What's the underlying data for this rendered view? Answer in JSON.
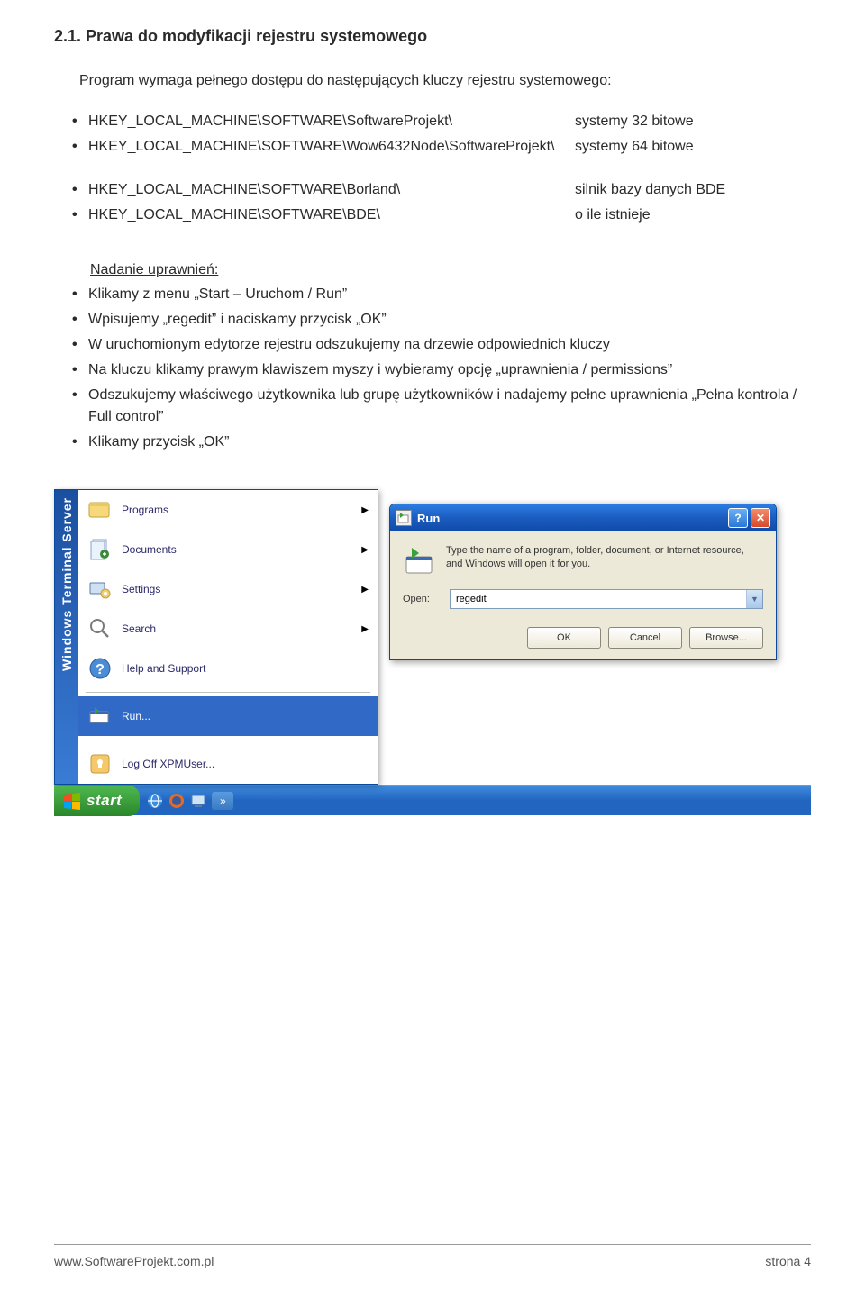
{
  "heading": "2.1. Prawa do modyfikacji rejestru systemowego",
  "intro": "Program wymaga pełnego dostępu do następujących kluczy rejestru systemowego:",
  "registry_group1": [
    {
      "path": "HKEY_LOCAL_MACHINE\\SOFTWARE\\SoftwareProjekt\\",
      "desc": "systemy 32 bitowe"
    },
    {
      "path": "HKEY_LOCAL_MACHINE\\SOFTWARE\\Wow6432Node\\SoftwareProjekt\\",
      "desc": "systemy 64 bitowe"
    }
  ],
  "registry_group2": [
    {
      "path": "HKEY_LOCAL_MACHINE\\SOFTWARE\\Borland\\",
      "desc": "silnik bazy danych BDE"
    },
    {
      "path": "HKEY_LOCAL_MACHINE\\SOFTWARE\\BDE\\",
      "desc": "o ile istnieje"
    }
  ],
  "subheading": "Nadanie uprawnień:",
  "steps": [
    "Klikamy z menu „Start – Uruchom / Run”",
    "Wpisujemy „regedit” i naciskamy przycisk „OK”",
    "W uruchomionym edytorze rejestru odszukujemy na drzewie odpowiednich kluczy",
    "Na kluczu klikamy prawym klawiszem myszy i wybieramy opcję „uprawnienia / permissions”",
    "Odszukujemy właściwego użytkownika lub grupę użytkowników i nadajemy pełne uprawnienia „Pełna kontrola / Full control”",
    "Klikamy przycisk „OK”"
  ],
  "start_menu": {
    "sidebar": "Windows   Terminal Server",
    "items": [
      {
        "label": "Programs",
        "arrow": true,
        "icon": "programs"
      },
      {
        "label": "Documents",
        "arrow": true,
        "icon": "documents"
      },
      {
        "label": "Settings",
        "arrow": true,
        "icon": "settings"
      },
      {
        "label": "Search",
        "arrow": true,
        "icon": "search"
      },
      {
        "label": "Help and Support",
        "arrow": false,
        "icon": "help"
      },
      {
        "label": "Run...",
        "arrow": false,
        "icon": "run",
        "hover": true
      },
      {
        "label": "Log Off XPMUser...",
        "arrow": false,
        "icon": "logoff"
      }
    ]
  },
  "run_dialog": {
    "title": "Run",
    "description": "Type the name of a program, folder, document, or Internet resource, and Windows will open it for you.",
    "open_label": "Open:",
    "input_value": "regedit",
    "buttons": {
      "ok": "OK",
      "cancel": "Cancel",
      "browse": "Browse..."
    }
  },
  "taskbar": {
    "start": "start"
  },
  "footer": {
    "left": "www.SoftwareProjekt.com.pl",
    "right": "strona 4"
  }
}
